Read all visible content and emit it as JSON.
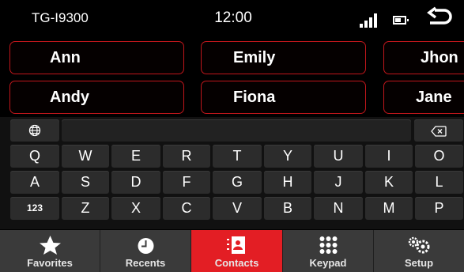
{
  "status": {
    "device": "TG-I9300",
    "time": "12:00"
  },
  "contacts": [
    "Ann",
    "Emily",
    "Jhon",
    "Andy",
    "Fiona",
    "Jane"
  ],
  "keyboard": {
    "row1": [
      "Q",
      "W",
      "E",
      "R",
      "T",
      "Y",
      "U",
      "I",
      "O"
    ],
    "row2": [
      "A",
      "S",
      "D",
      "F",
      "G",
      "H",
      "J",
      "K",
      "L"
    ],
    "row3": [
      "123",
      "Z",
      "X",
      "C",
      "V",
      "B",
      "N",
      "M",
      "P"
    ]
  },
  "nav": [
    {
      "label": "Favorites",
      "icon": "star-icon"
    },
    {
      "label": "Recents",
      "icon": "clock-icon"
    },
    {
      "label": "Contacts",
      "icon": "contact-card-icon",
      "active": true
    },
    {
      "label": "Keypad",
      "icon": "keypad-grid-icon"
    },
    {
      "label": "Setup",
      "icon": "gears-icon"
    }
  ],
  "colors": {
    "accent": "#e31e24",
    "contact_border": "#c0161b",
    "key": "#2c2c2c",
    "nav_bg": "#3a3a3a"
  }
}
